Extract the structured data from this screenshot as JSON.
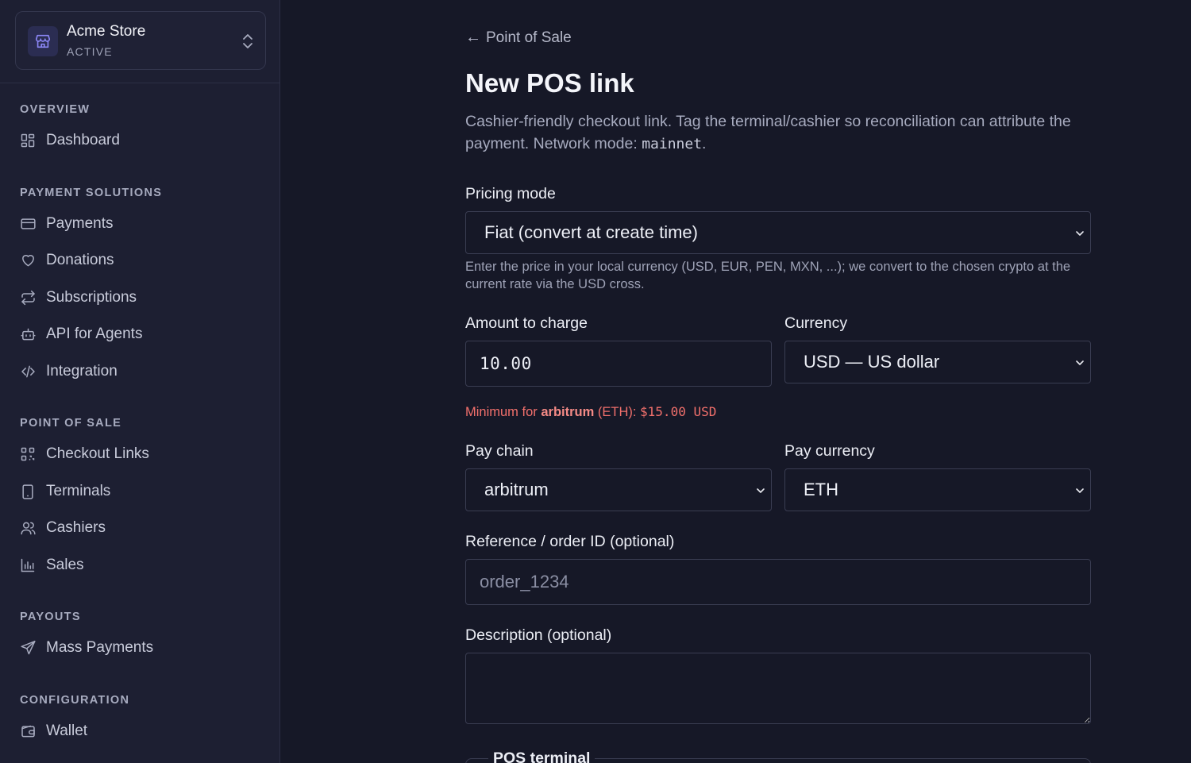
{
  "store": {
    "name": "Acme Store",
    "status": "ACTIVE"
  },
  "sidebar": {
    "sections": [
      {
        "label": "OVERVIEW",
        "items": [
          {
            "label": "Dashboard",
            "icon": "dashboard-icon"
          }
        ]
      },
      {
        "label": "PAYMENT SOLUTIONS",
        "items": [
          {
            "label": "Payments",
            "icon": "card-icon"
          },
          {
            "label": "Donations",
            "icon": "heart-icon"
          },
          {
            "label": "Subscriptions",
            "icon": "repeat-icon"
          },
          {
            "label": "API for Agents",
            "icon": "robot-icon"
          },
          {
            "label": "Integration",
            "icon": "code-icon"
          }
        ]
      },
      {
        "label": "POINT OF SALE",
        "items": [
          {
            "label": "Checkout Links",
            "icon": "qr-icon"
          },
          {
            "label": "Terminals",
            "icon": "tablet-icon"
          },
          {
            "label": "Cashiers",
            "icon": "users-icon"
          },
          {
            "label": "Sales",
            "icon": "bar-chart-icon"
          }
        ]
      },
      {
        "label": "PAYOUTS",
        "items": [
          {
            "label": "Mass Payments",
            "icon": "send-icon"
          }
        ]
      },
      {
        "label": "CONFIGURATION",
        "items": [
          {
            "label": "Wallet",
            "icon": "wallet-icon"
          }
        ]
      }
    ]
  },
  "header": {
    "back_arrow": "←",
    "back_label": "Point of Sale",
    "title": "New POS link",
    "description": "Cashier-friendly checkout link. Tag the terminal/cashier so reconciliation can attribute the payment. Network mode: ",
    "network_mode": "mainnet",
    "description_end": "."
  },
  "form": {
    "pricing_mode": {
      "label": "Pricing mode",
      "value": "Fiat (convert at create time)",
      "help": "Enter the price in your local currency (USD, EUR, PEN, MXN, ...); we convert to the chosen crypto at the current rate via the USD cross."
    },
    "amount": {
      "label": "Amount to charge",
      "value": "10.00"
    },
    "currency": {
      "label": "Currency",
      "value": "USD — US dollar"
    },
    "minimum": {
      "prefix": "Minimum for ",
      "chain": "arbitrum",
      "middle": " (ETH): ",
      "amount": "$15.00 USD"
    },
    "pay_chain": {
      "label": "Pay chain",
      "value": "arbitrum"
    },
    "pay_currency": {
      "label": "Pay currency",
      "value": "ETH"
    },
    "reference": {
      "label": "Reference / order ID (optional)",
      "placeholder": "order_1234"
    },
    "description": {
      "label": "Description (optional)",
      "placeholder": ""
    },
    "pos_terminal": {
      "legend": "POS terminal"
    }
  },
  "colors": {
    "background": "#161827",
    "sidebar": "#1d1f32",
    "accent": "#7b7cf0",
    "error": "#f2706c"
  }
}
